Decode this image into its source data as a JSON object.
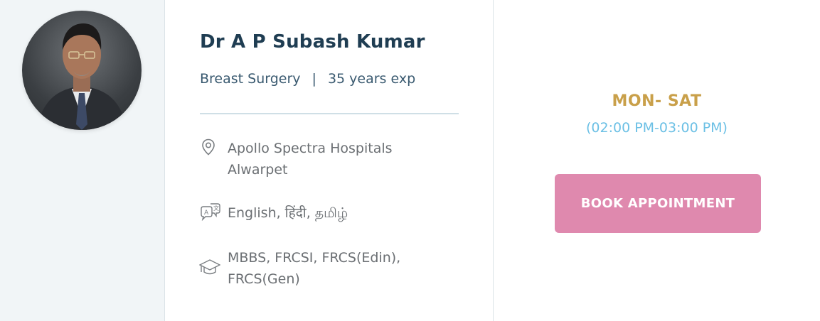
{
  "doctor": {
    "name": "Dr A P Subash Kumar",
    "specialty": "Breast Surgery",
    "separator": "|",
    "experience": "35 years exp",
    "location": "Apollo Spectra Hospitals Alwarpet",
    "languages": "English, हिंदी, தமிழ்",
    "qualifications": "MBBS, FRCSI, FRCS(Edin), FRCS(Gen)"
  },
  "schedule": {
    "days": "MON- SAT",
    "hours": "(02:00 PM-03:00 PM)"
  },
  "actions": {
    "book_label": "BOOK APPOINTMENT"
  },
  "icons": {
    "location": "map-pin-icon",
    "languages": "translate-icon",
    "qualifications": "graduation-cap-icon"
  },
  "colors": {
    "name": "#1f3d52",
    "days": "#c9a04a",
    "hours": "#6cc0e5",
    "button": "#df89ae",
    "left_panel": "#f1f5f7"
  }
}
